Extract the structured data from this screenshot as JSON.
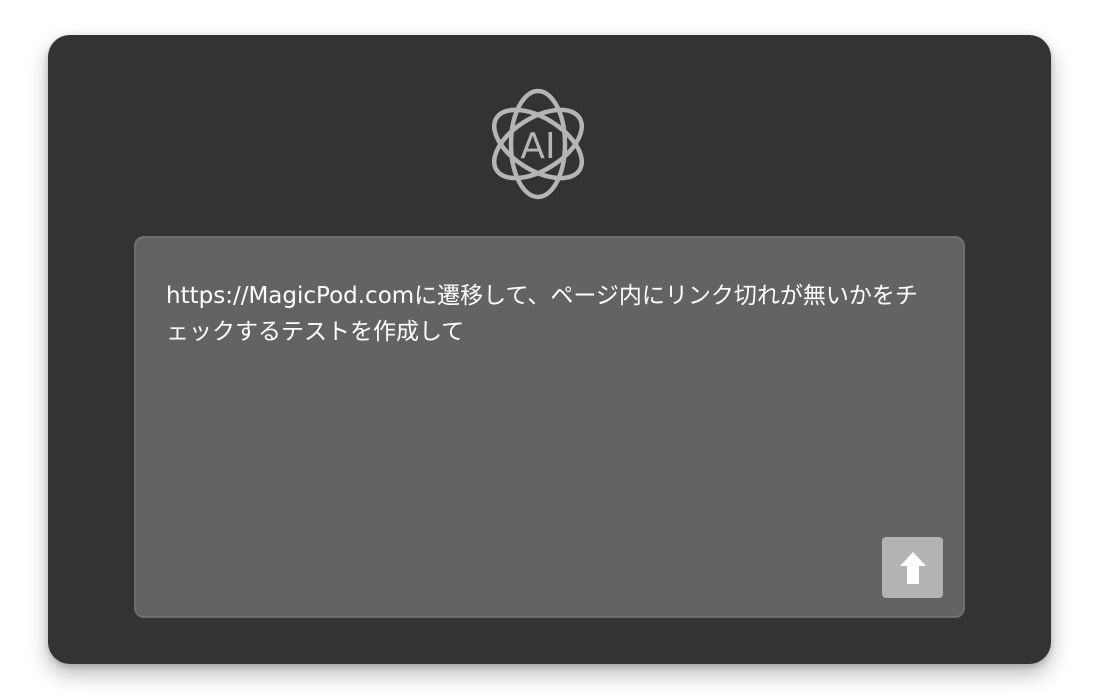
{
  "logo": {
    "icon": "ai-atom-icon",
    "text": "AI",
    "color": "#b5b5b5"
  },
  "prompt": {
    "text": "https://MagicPod.comに遷移して、ページ内にリンク切れが無いかをチェックするテストを作成して"
  },
  "send_button": {
    "icon": "arrow-up-icon",
    "color": "#b3b3b3"
  },
  "colors": {
    "panel": "#333333",
    "input_bg": "#636363",
    "text": "#ffffff"
  }
}
